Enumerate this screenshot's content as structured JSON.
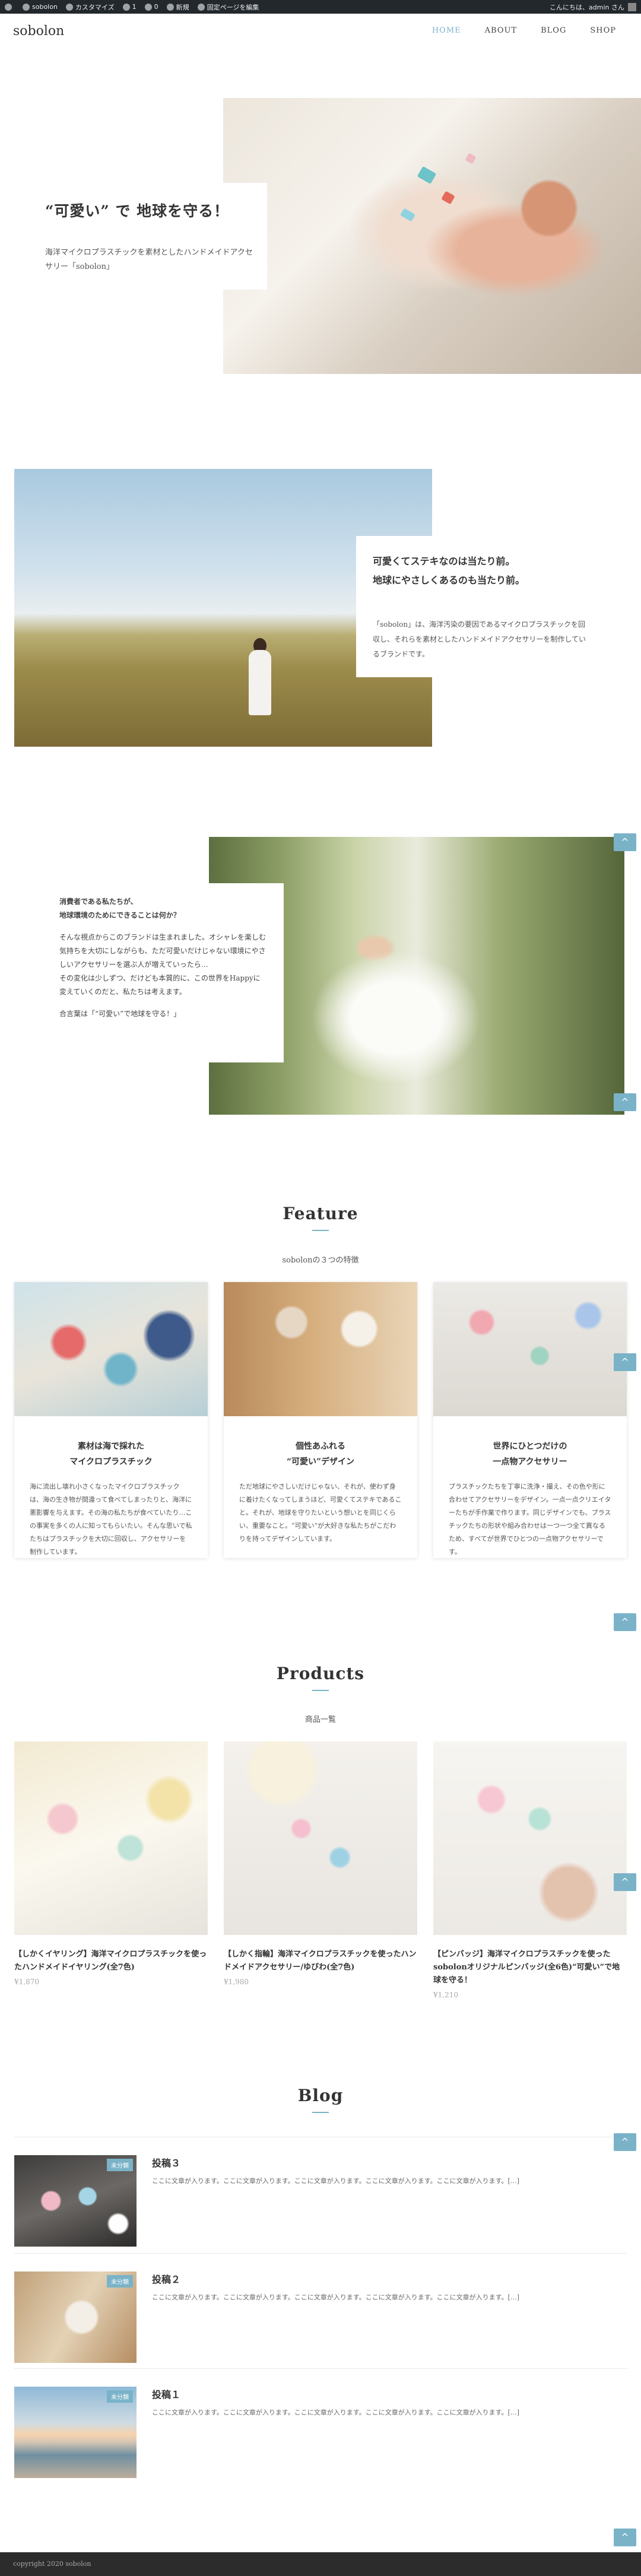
{
  "adminbar": {
    "site": "sobolon",
    "customize": "カスタマイズ",
    "comments_count": "1",
    "comments_pending": "0",
    "new": "新規",
    "edit_fixed": "固定ページを編集",
    "greeting": "こんにちは、admin さん"
  },
  "header": {
    "site_title": "sobolon",
    "nav": [
      "HOME",
      "ABOUT",
      "BLOG",
      "SHOP"
    ]
  },
  "hero": {
    "title": "“可愛い” で 地球を守る！",
    "text": "海洋マイクロプラスチックを素材としたハンドメイドアクセサリー「sobolon」"
  },
  "section2": {
    "title_line1": "可愛くてステキなのは当たり前。",
    "title_line2": "地球にやさしくあるのも当たり前。",
    "text": "「sobolon」は、海洋汚染の要因であるマイクロプラスチックを回収し、それらを素材としたハンドメイドアクセサリーを制作しているブランドです。"
  },
  "section3": {
    "q1": "消費者である私たちが、",
    "q2": "地球環境のためにできることは何か？",
    "p1": "そんな視点からこのブランドは生まれました。オシャレを楽しむ気持ちを大切にしながらも、ただ可愛いだけじゃない環境にやさしいアクセサリーを選ぶ人が増えていったら…",
    "p2": "その変化は少しずつ、だけども本質的に、この世界をHappyに変えていくのだと、私たちは考えます。",
    "p3": "合言葉は「“可愛い”で地球を守る！」"
  },
  "feature": {
    "heading": "Feature",
    "sub": "sobolonの３つの特徴",
    "cards": [
      {
        "title1": "素材は海で採れた",
        "title2": "マイクロプラスチック",
        "text": "海に流出し壊れ小さくなったマイクロプラスチックは、海の生き物が間違って食べてしまったりと、海洋に悪影響を与えます。その海の私たちが食べていたり…この事実を多くの人に知ってもらいたい。そんな思いで私たちはプラスチックを大切に回収し、アクセサリーを制作しています。"
      },
      {
        "title1": "個性あふれる",
        "title2": "“可愛い”デザイン",
        "text": "ただ地球にやさしいだけじゃない、それが、使わず身に着けたくなってしまうほど、可愛くてステキであること。それが、地球を守りたいという想いとを同じくらい、重要なこと。“可愛い”が大好きな私たちがこだわりを持ってデザインしています。"
      },
      {
        "title1": "世界にひとつだけの",
        "title2": "一点物アクセサリー",
        "text": "プラスチックたちを丁寧に洗浄・撮え、その色や形に合わせてアクセサリーをデザイン。一点一点クリエイターたちが手作業で作ります。同じデザインでも、プラスチックたちの形状や組み合わせは一つ一つ全て異なるため、すべてが世界でひとつの一点物アクセサリーです。"
      }
    ]
  },
  "products": {
    "heading": "Products",
    "sub": "商品一覧",
    "items": [
      {
        "name": "【しかくイヤリング】海洋マイクロプラスチックを使ったハンドメイドイヤリング(全7色)",
        "price": "¥1,870"
      },
      {
        "name": "【しかく指輪】海洋マイクロプラスチックを使ったハンドメイドアクセサリー/ゆびわ(全7色)",
        "price": "¥1,980"
      },
      {
        "name": "【ピンバッジ】海洋マイクロプラスチックを使ったsobolonオリジナルピンバッジ(全6色)“可愛い”で地球を守る！",
        "price": "¥1,210"
      }
    ]
  },
  "blog": {
    "heading": "Blog",
    "posts": [
      {
        "tag": "未分類",
        "title": "投稿３",
        "excerpt": "ここに文章が入ります。ここに文章が入ります。ここに文章が入ります。ここに文章が入ります。ここに文章が入ります。[…]"
      },
      {
        "tag": "未分類",
        "title": "投稿２",
        "excerpt": "ここに文章が入ります。ここに文章が入ります。ここに文章が入ります。ここに文章が入ります。ここに文章が入ります。[…]"
      },
      {
        "tag": "未分類",
        "title": "投稿１",
        "excerpt": "ここに文章が入ります。ここに文章が入ります。ここに文章が入ります。ここに文章が入ります。ここに文章が入ります。[…]"
      }
    ]
  },
  "totop_icon": "^",
  "footer": {
    "copyright": "copyright 2020 sobolon"
  },
  "colors": {
    "accent": "#7ab3c8",
    "adminbar": "#23282d",
    "footer": "#2c2c2c"
  }
}
